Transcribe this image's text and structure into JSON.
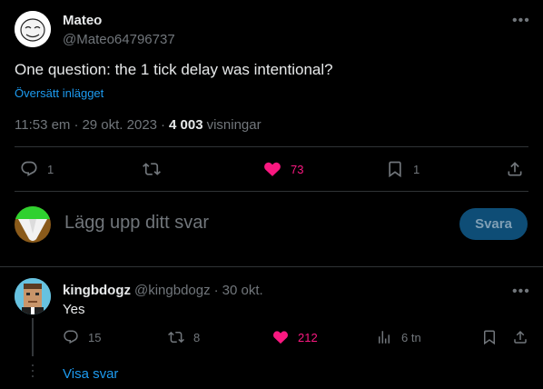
{
  "tweet": {
    "author_name": "Mateo",
    "author_handle": "@Mateo64796737",
    "text": "One question: the 1 tick delay was intentional?",
    "translate_label": "Översätt inlägget",
    "time": "11:53 em",
    "date": "29 okt. 2023",
    "separator": "·",
    "views_count": "4 003",
    "views_label": "visningar",
    "actions": {
      "reply_count": "1",
      "retweet_count": "",
      "like_count": "73",
      "bookmark_count": "1"
    }
  },
  "composer": {
    "placeholder": "Lägg upp ditt svar",
    "submit_label": "Svara"
  },
  "reply": {
    "author_name": "kingbdogz",
    "author_handle": "@kingbdogz",
    "separator": "·",
    "date": "30 okt.",
    "text": "Yes",
    "actions": {
      "reply_count": "15",
      "retweet_count": "8",
      "like_count": "212",
      "views_count": "6 tn"
    },
    "show_replies_label": "Visa svar"
  },
  "colors": {
    "background": "#000000",
    "accent": "#1d9bf0",
    "like": "#f91880",
    "muted": "#71767b",
    "divider": "#2f3336"
  }
}
